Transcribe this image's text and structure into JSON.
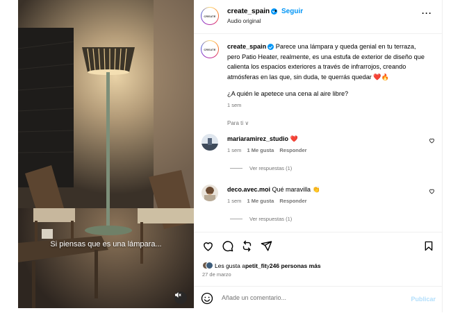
{
  "media": {
    "caption": "Si piensas que es una lámpara...",
    "mute_icon": "speaker-muted-icon"
  },
  "header": {
    "avatar_text": "CREATE",
    "username": "create_spain",
    "separator": "•",
    "follow_label": "Seguir",
    "audio": "Audio original",
    "more": "···"
  },
  "post": {
    "username": "create_spain",
    "text": "Parece una lámpara y queda genial en tu terraza, pero Patio Heater, realmente, es una estufa de exterior de diseño que calienta los espacios exteriores a través de infrarrojos, creando atmósferas en las que, sin duda, te querrás quedar ❤️🔥",
    "question": "¿A quién le apetece una cena al aire libre?",
    "time": "1 sem"
  },
  "for_you": "Para ti ∨",
  "comments": [
    {
      "username": "mariaramirez_studio",
      "text": "❤️",
      "time": "1 sem",
      "likes": "1 Me gusta",
      "reply": "Responder",
      "replies": "Ver respuestas (1)"
    },
    {
      "username": "deco.avec.moi",
      "text": "Qué maravilla 👏",
      "time": "1 sem",
      "likes": "1 Me gusta",
      "reply": "Responder",
      "replies": "Ver respuestas (1)"
    }
  ],
  "actions": {
    "likes_prefix": "Les gusta a ",
    "likes_user": "petit_fit",
    "likes_suffix": " y ",
    "likes_count": "246 personas más",
    "date": "27 de marzo"
  },
  "comment_bar": {
    "placeholder": "Añade un comentario...",
    "publish": "Publicar"
  },
  "colors": {
    "accent": "#0095f6",
    "muted": "#737373",
    "publish_disabled": "#b2dffc"
  }
}
